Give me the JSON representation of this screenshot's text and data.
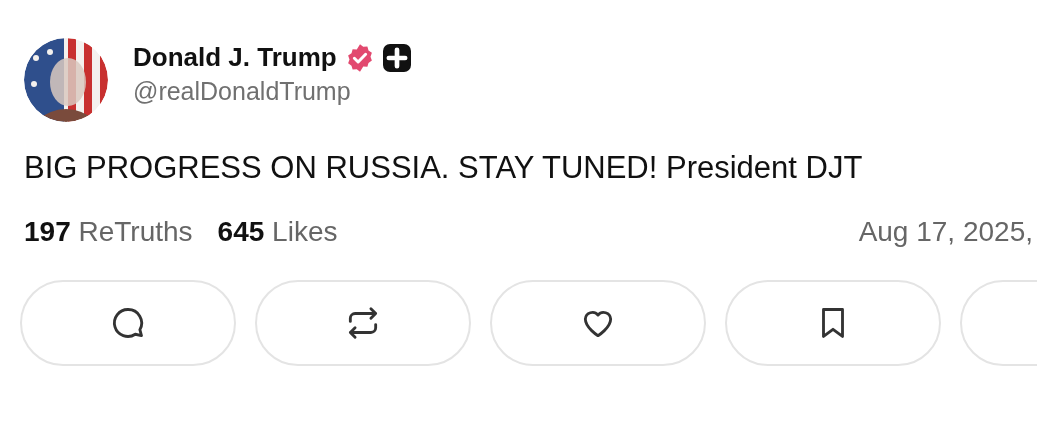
{
  "author": {
    "name": "Donald J. Trump",
    "verified": true,
    "plus_badge": true,
    "handle": "@realDonaldTrump"
  },
  "post": {
    "text": "BIG PROGRESS ON RUSSIA. STAY TUNED! President DJT"
  },
  "stats": [
    {
      "count": "197",
      "label": "ReTruths"
    },
    {
      "count": "645",
      "label": "Likes"
    }
  ],
  "date": "Aug 17, 2025,",
  "actions": [
    {
      "kind": "reply"
    },
    {
      "kind": "retruth"
    },
    {
      "kind": "like"
    },
    {
      "kind": "bookmark"
    },
    {
      "kind": "other"
    }
  ]
}
